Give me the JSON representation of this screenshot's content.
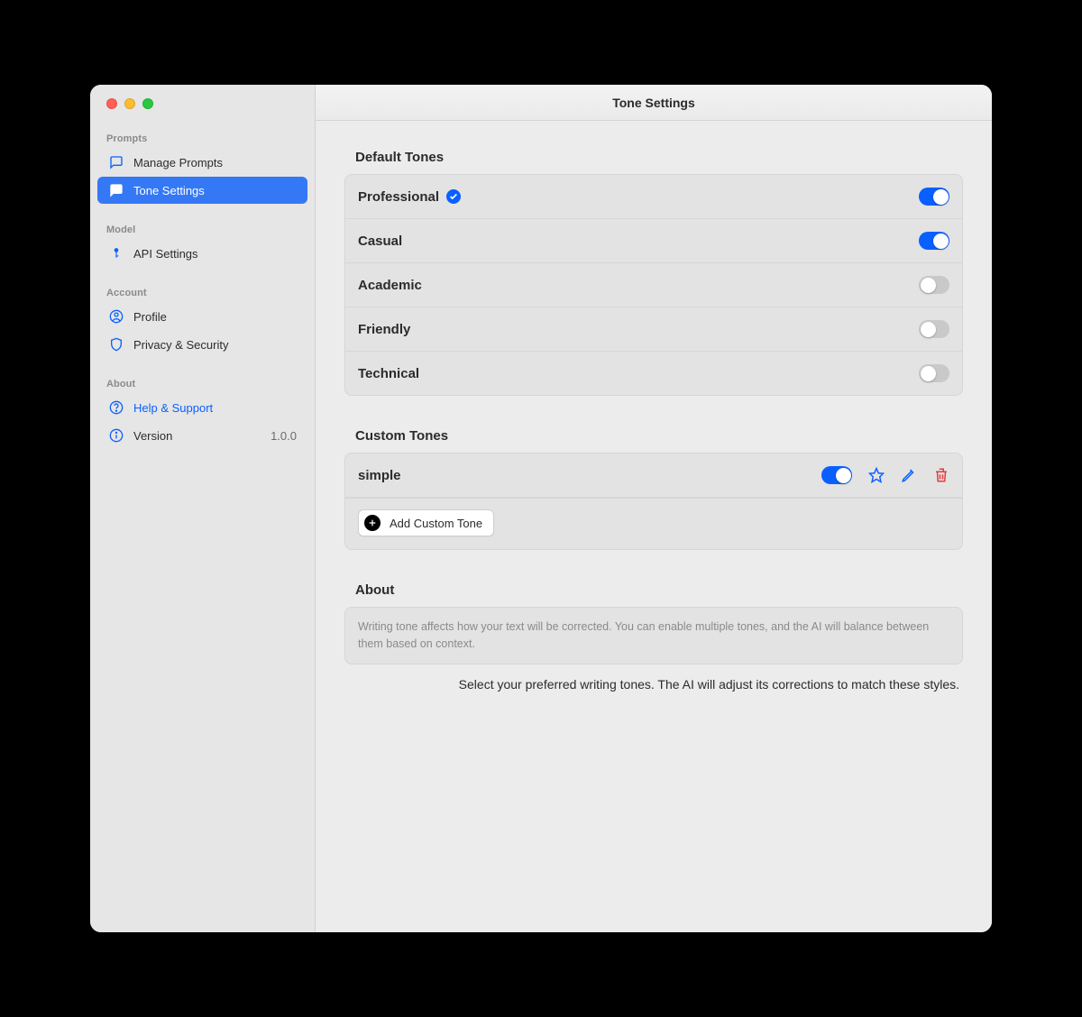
{
  "window": {
    "title": "Tone Settings"
  },
  "sidebar": {
    "sections": [
      {
        "label": "Prompts",
        "items": [
          {
            "label": "Manage Prompts",
            "icon": "chat-icon",
            "selected": false,
            "accent": false
          },
          {
            "label": "Tone Settings",
            "icon": "chat-icon",
            "selected": true,
            "accent": false
          }
        ]
      },
      {
        "label": "Model",
        "items": [
          {
            "label": "API Settings",
            "icon": "key-icon",
            "selected": false,
            "accent": false
          }
        ]
      },
      {
        "label": "Account",
        "items": [
          {
            "label": "Profile",
            "icon": "user-circle-icon",
            "selected": false,
            "accent": false
          },
          {
            "label": "Privacy & Security",
            "icon": "shield-icon",
            "selected": false,
            "accent": false
          }
        ]
      },
      {
        "label": "About",
        "items": [
          {
            "label": "Help & Support",
            "icon": "question-circle-icon",
            "selected": false,
            "accent": true
          },
          {
            "label": "Version",
            "icon": "info-circle-icon",
            "selected": false,
            "accent": false,
            "trailing": "1.0.0"
          }
        ]
      }
    ]
  },
  "default_tones": {
    "title": "Default Tones",
    "items": [
      {
        "name": "Professional",
        "enabled": true,
        "default_badge": true
      },
      {
        "name": "Casual",
        "enabled": true,
        "default_badge": false
      },
      {
        "name": "Academic",
        "enabled": false,
        "default_badge": false
      },
      {
        "name": "Friendly",
        "enabled": false,
        "default_badge": false
      },
      {
        "name": "Technical",
        "enabled": false,
        "default_badge": false
      }
    ]
  },
  "custom_tones": {
    "title": "Custom Tones",
    "items": [
      {
        "name": "simple",
        "enabled": true,
        "favorite": false
      }
    ],
    "add_label": "Add Custom Tone"
  },
  "about": {
    "title": "About",
    "body": "Writing tone affects how your text will be corrected. You can enable multiple tones, and the AI will balance between them based on context.",
    "footer": "Select your preferred writing tones. The AI will adjust its corrections to match these styles."
  }
}
